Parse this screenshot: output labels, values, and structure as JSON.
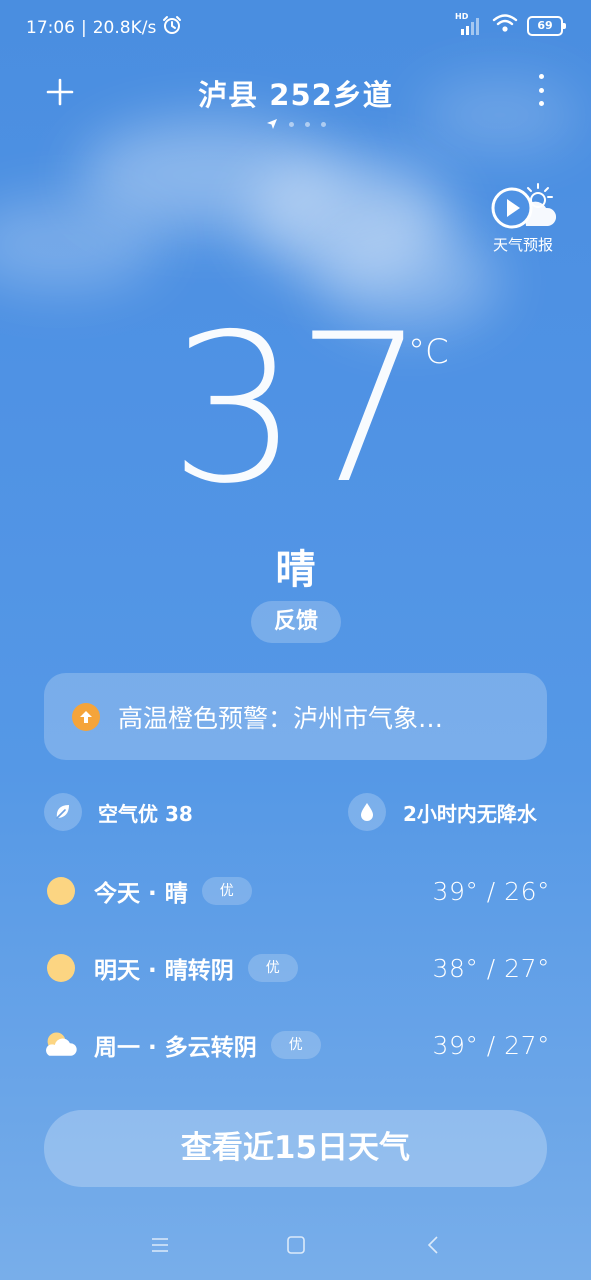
{
  "status_bar": {
    "time": "17:06",
    "network_speed": "20.8K/s",
    "network_type": "HD",
    "battery": "69"
  },
  "header": {
    "location": "泸县 252乡道",
    "page_count": 4,
    "active_page": 0
  },
  "forecast_video": {
    "label": "天气预报"
  },
  "current": {
    "temperature": "37",
    "unit": "°C",
    "condition": "晴",
    "feedback_label": "反馈"
  },
  "alert": {
    "text": "高温橙色预警：泸州市气象…",
    "color": "#f5a43a"
  },
  "info": {
    "air_quality": "空气优 38",
    "precipitation": "2小时内无降水"
  },
  "daily": [
    {
      "label": "今天 · 晴",
      "aqi": "优",
      "temps": "39° / 26°",
      "icon": "sun-icon"
    },
    {
      "label": "明天 · 晴转阴",
      "aqi": "优",
      "temps": "38° / 27°",
      "icon": "sun-icon"
    },
    {
      "label": "周一 · 多云转阴",
      "aqi": "优",
      "temps": "39° / 27°",
      "icon": "partly-cloudy-icon"
    }
  ],
  "forecast_15_label": "查看近15日天气"
}
